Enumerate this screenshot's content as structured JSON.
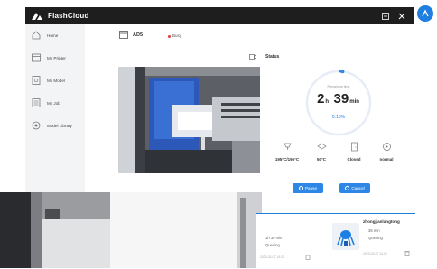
{
  "app": {
    "name": "FlashCloud"
  },
  "sidebar": {
    "items": [
      {
        "label": "Home",
        "icon": "home-icon"
      },
      {
        "label": "My Printer",
        "icon": "printer-icon"
      },
      {
        "label": "My Model",
        "icon": "model-icon"
      },
      {
        "label": "My Job",
        "icon": "job-icon"
      },
      {
        "label": "Model Library",
        "icon": "library-icon"
      }
    ]
  },
  "printer": {
    "name": "AD5",
    "status": "Busy",
    "status_color": "#e53935"
  },
  "section": {
    "title": "Status"
  },
  "progress": {
    "label": "Remaining time",
    "hours": "2",
    "hours_unit": "h",
    "minutes": "39",
    "minutes_unit": "min",
    "percent_text": "0.18%",
    "fraction": 0.02,
    "accent": "#2e86e6"
  },
  "stats": [
    {
      "value": "195°C/195°C",
      "icon": "nozzle-icon"
    },
    {
      "value": "50°C",
      "icon": "bed-icon"
    },
    {
      "value": "Closed",
      "icon": "door-icon"
    },
    {
      "value": "normal",
      "icon": "fan-icon"
    }
  ],
  "buttons": {
    "pause": "Pause",
    "cancel": "Cancel"
  },
  "jobs": [
    {
      "name": "",
      "time": "1h 39 min",
      "status": "Queuing",
      "date": "2023-03-07 14:20"
    },
    {
      "name": "zhongjianlangtong",
      "time": "36 min",
      "status": "Queuing",
      "date": "2023-03-07 14:20"
    }
  ]
}
